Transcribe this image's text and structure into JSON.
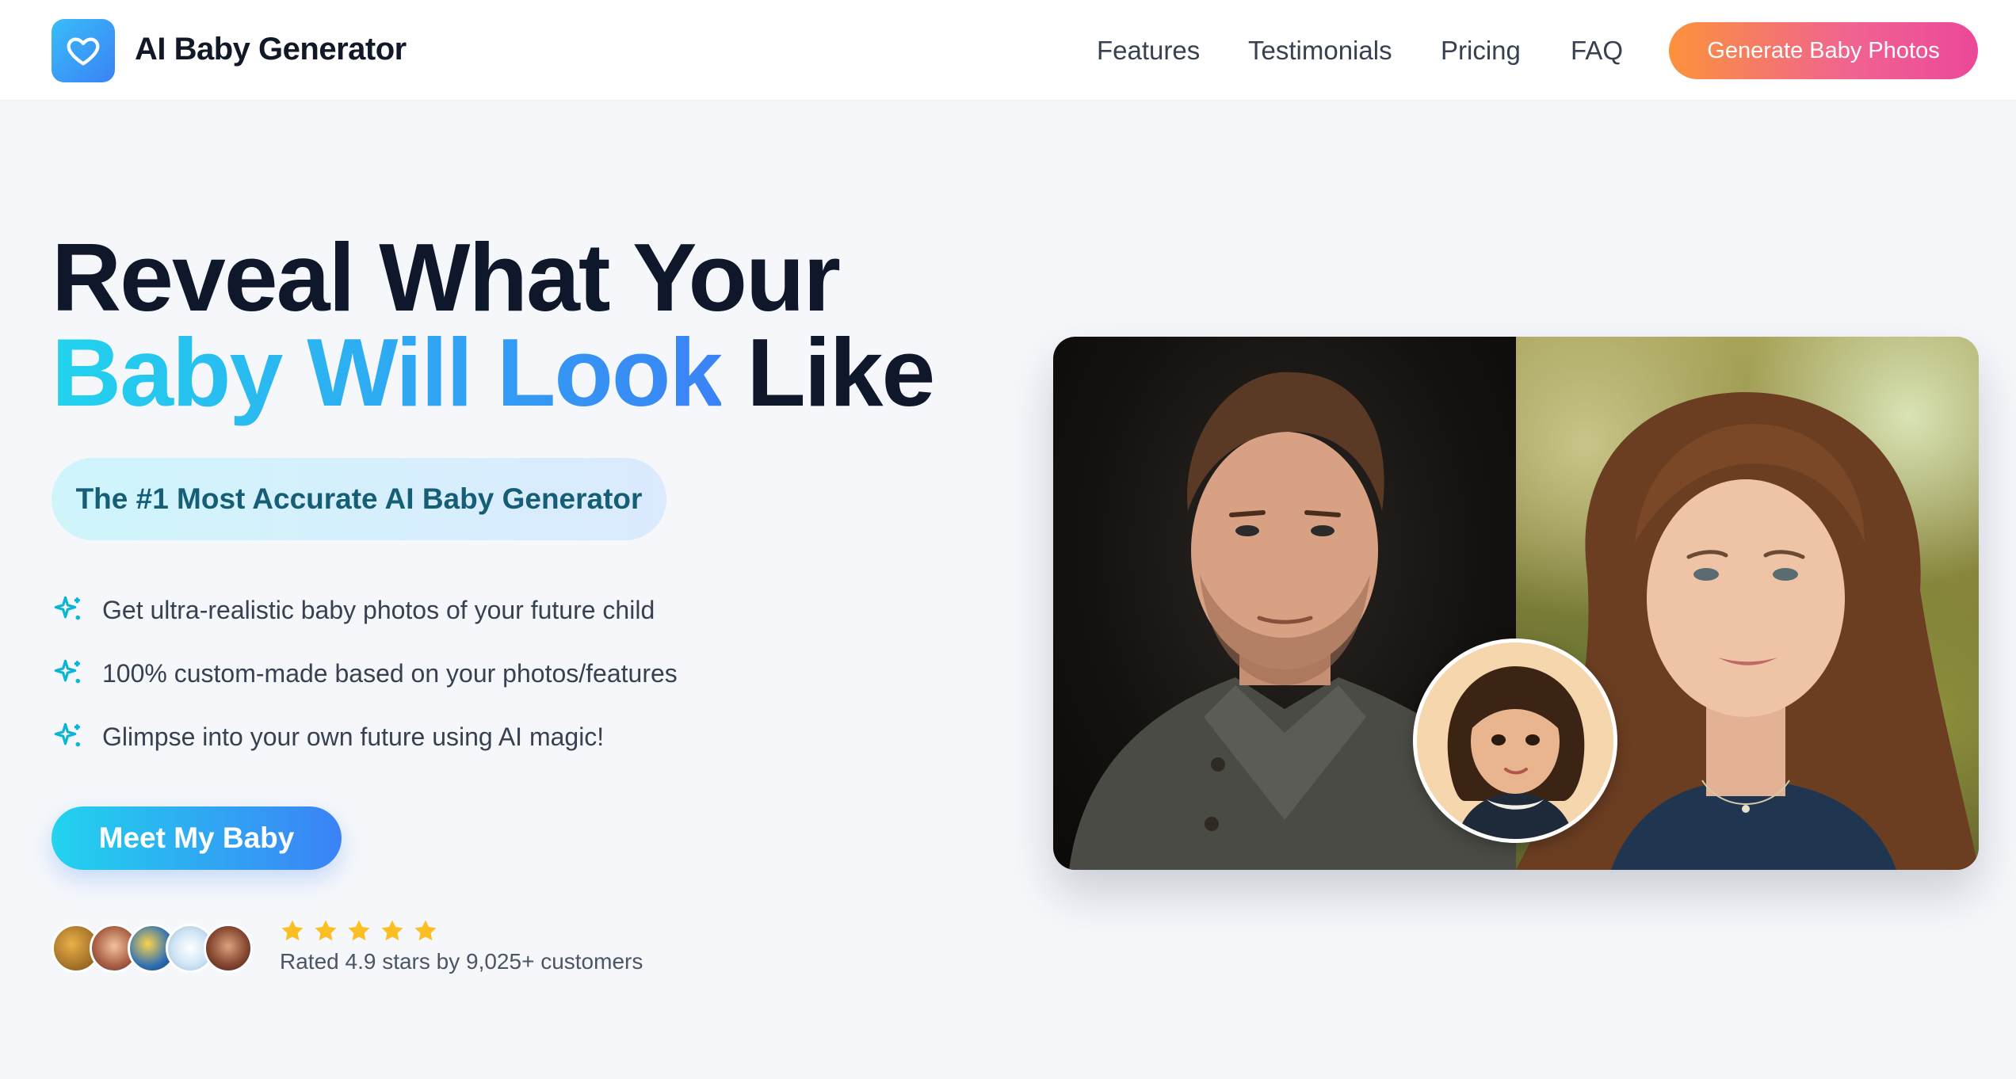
{
  "header": {
    "brand": "AI Baby Generator",
    "nav": [
      "Features",
      "Testimonials",
      "Pricing",
      "FAQ"
    ],
    "cta": "Generate Baby Photos"
  },
  "hero": {
    "headline_line1": "Reveal What Your",
    "headline_highlight": "Baby Will Look",
    "headline_end": "Like",
    "pill": "The #1 Most Accurate AI Baby Generator",
    "features": [
      "Get ultra-realistic baby photos of your future child",
      "100% custom-made based on your photos/features",
      "Glimpse into your own future using AI magic!"
    ],
    "cta": "Meet My Baby",
    "rating_text": "Rated 4.9 stars by 9,025+ customers",
    "stars": 5
  },
  "colors": {
    "accent_cyan": "#22d3ee",
    "accent_blue": "#3b82f6",
    "cta_orange": "#fb923c",
    "cta_pink": "#ec4899",
    "star_yellow": "#fbbf24"
  },
  "icons": {
    "logo": "heart-icon",
    "feature_bullet": "sparkles-icon",
    "rating": "star-icon"
  }
}
